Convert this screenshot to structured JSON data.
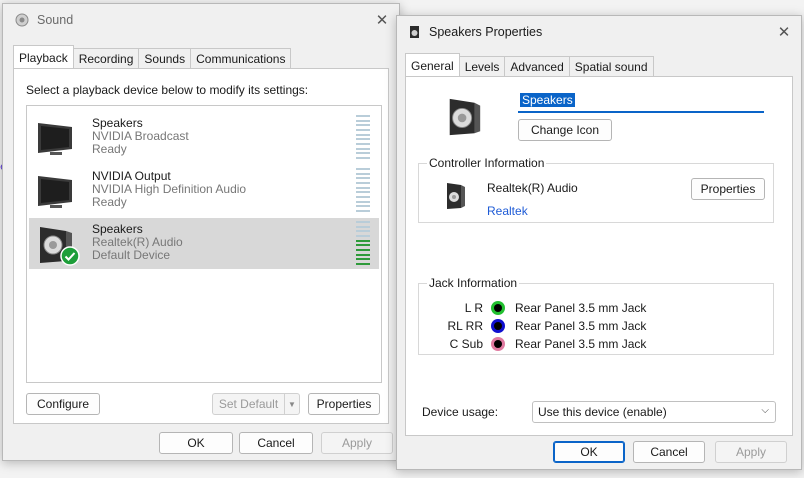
{
  "sound_window": {
    "title": "Sound",
    "tabs": [
      "Playback",
      "Recording",
      "Sounds",
      "Communications"
    ],
    "instruction": "Select a playback device below to modify its settings:",
    "devices": [
      {
        "name": "Speakers",
        "sub": "NVIDIA Broadcast",
        "status": "Ready"
      },
      {
        "name": "NVIDIA Output",
        "sub": "NVIDIA High Definition Audio",
        "status": "Ready"
      },
      {
        "name": "Speakers",
        "sub": "Realtek(R) Audio",
        "status": "Default Device"
      }
    ],
    "configure_label": "Configure",
    "set_default_label": "Set Default",
    "properties_label": "Properties",
    "ok_label": "OK",
    "cancel_label": "Cancel",
    "apply_label": "Apply"
  },
  "props_window": {
    "title": "Speakers Properties",
    "tabs": [
      "General",
      "Levels",
      "Advanced",
      "Spatial sound"
    ],
    "name_value": "Speakers",
    "change_icon_label": "Change Icon",
    "controller": {
      "legend": "Controller Information",
      "name": "Realtek(R) Audio",
      "vendor_link": "Realtek",
      "properties_label": "Properties"
    },
    "jack": {
      "legend": "Jack Information",
      "rows": [
        {
          "label": "L R",
          "text": "Rear Panel 3.5 mm Jack",
          "color": "#22c030"
        },
        {
          "label": "RL RR",
          "text": "Rear Panel 3.5 mm Jack",
          "color": "#1010d0"
        },
        {
          "label": "C Sub",
          "text": "Rear Panel 3.5 mm Jack",
          "color": "#e07aa0"
        }
      ]
    },
    "device_usage_label": "Device usage:",
    "device_usage_value": "Use this device (enable)",
    "ok_label": "OK",
    "cancel_label": "Cancel",
    "apply_label": "Apply"
  }
}
